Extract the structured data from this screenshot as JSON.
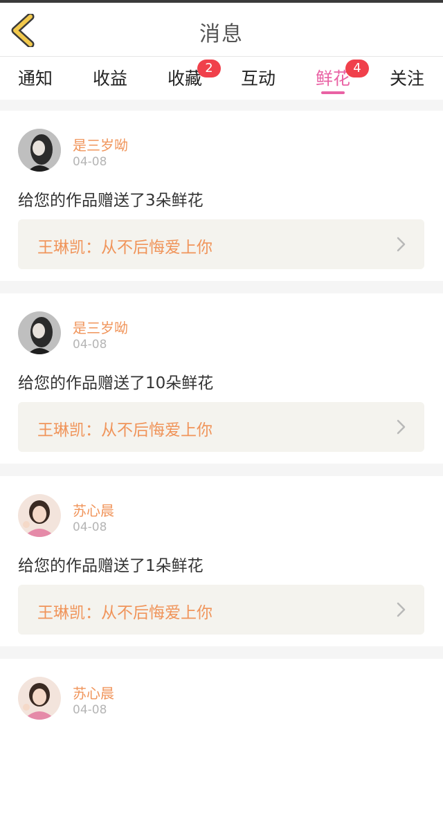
{
  "header": {
    "title": "消息"
  },
  "tabs": [
    {
      "label": "通知",
      "badge": null,
      "active": false
    },
    {
      "label": "收益",
      "badge": null,
      "active": false
    },
    {
      "label": "收藏",
      "badge": "2",
      "active": false
    },
    {
      "label": "互动",
      "badge": null,
      "active": false
    },
    {
      "label": "鲜花",
      "badge": "4",
      "active": true
    },
    {
      "label": "关注",
      "badge": null,
      "active": false
    }
  ],
  "colors": {
    "accent": "#e962a4",
    "username": "#f0945a",
    "badge": "#f0404b",
    "back_arrow": "#f2c94c"
  },
  "feed": [
    {
      "username": "是三岁呦",
      "date": "04-08",
      "message": "给您的作品赠送了3朵鲜花",
      "work": "王琳凯：从不后悔爱上你",
      "avatar": "avatar-dark-hair"
    },
    {
      "username": "是三岁呦",
      "date": "04-08",
      "message": "给您的作品赠送了10朵鲜花",
      "work": "王琳凯：从不后悔爱上你",
      "avatar": "avatar-dark-hair"
    },
    {
      "username": "苏心晨",
      "date": "04-08",
      "message": "给您的作品赠送了1朵鲜花",
      "work": "王琳凯：从不后悔爱上你",
      "avatar": "avatar-pink-hoodie"
    },
    {
      "username": "苏心晨",
      "date": "04-08",
      "message": "",
      "work": "",
      "avatar": "avatar-pink-hoodie"
    }
  ]
}
